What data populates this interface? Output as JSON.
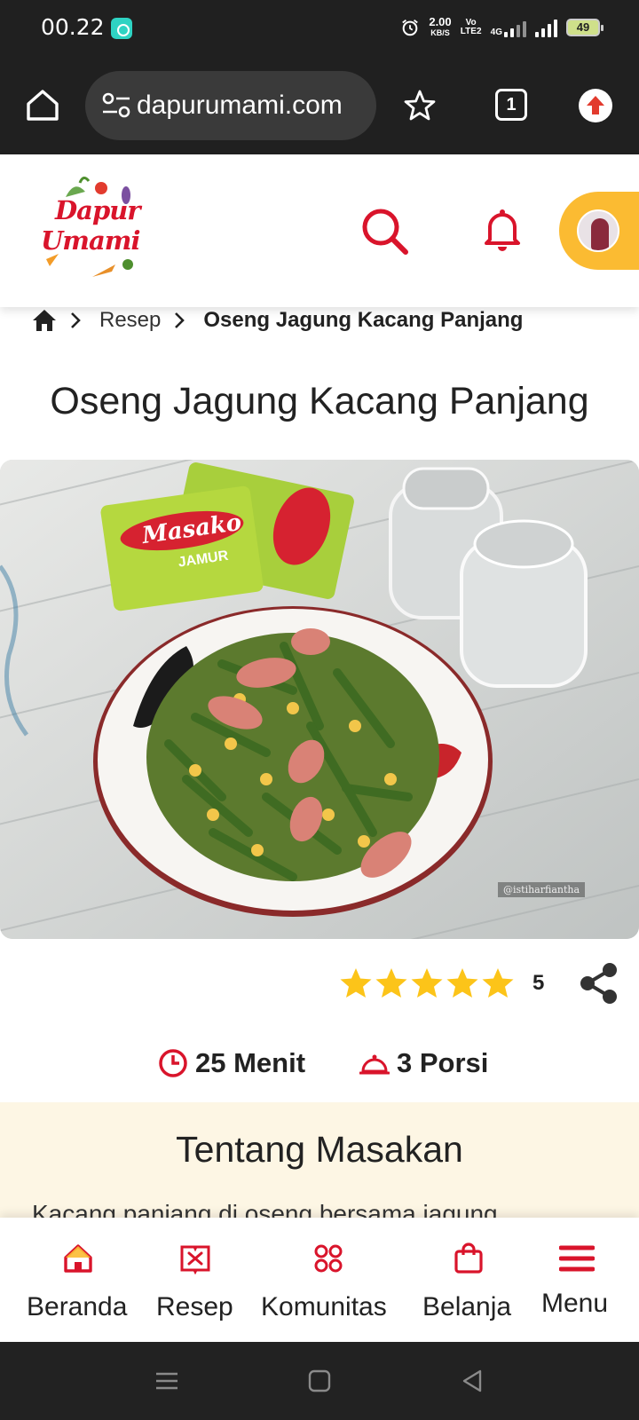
{
  "status_bar": {
    "time": "00.22",
    "net_speed_value": "2.00",
    "net_speed_unit": "KB/S",
    "volte_label": "Vo LTE2",
    "network_type": "4G",
    "battery": "49"
  },
  "browser": {
    "url": "dapurumami.com",
    "tab_count": "1"
  },
  "site": {
    "logo_line1": "Dapur",
    "logo_line2": "Umami"
  },
  "breadcrumb": {
    "section": "Resep",
    "current": "Oseng Jagung Kacang Panjang"
  },
  "recipe": {
    "title": "Oseng Jagung Kacang Panjang",
    "image_credit": "@istiharfiantha",
    "package_brand": "Masako",
    "package_variant": "JAMUR",
    "rating_value": "5",
    "rating_stars": 5,
    "time": "25 Menit",
    "portion": "3 Porsi"
  },
  "about": {
    "title": "Tentang Masakan",
    "text": "Kacang panjang di oseng bersama jagung"
  },
  "bottom_nav": {
    "items": [
      {
        "label": "Beranda",
        "icon": "home-icon"
      },
      {
        "label": "Resep",
        "icon": "recipe-book-icon"
      },
      {
        "label": "Komunitas",
        "icon": "community-icon"
      },
      {
        "label": "Belanja",
        "icon": "shopping-bag-icon"
      },
      {
        "label": "Menu",
        "icon": "hamburger-menu-icon"
      }
    ]
  },
  "colors": {
    "brand_red": "#d9142b",
    "accent_yellow": "#fbbb32",
    "star_yellow": "#fcc419",
    "about_bg": "#fdf6e4"
  }
}
